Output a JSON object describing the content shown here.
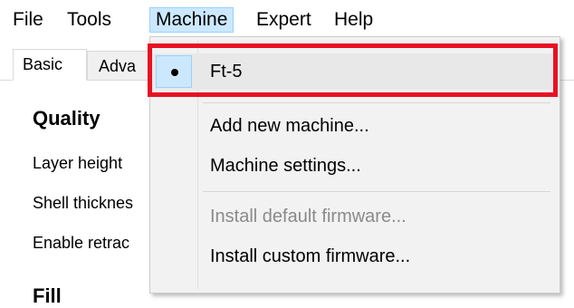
{
  "menubar": {
    "items": [
      {
        "label": "File"
      },
      {
        "label": "Tools"
      },
      {
        "label": "Machine"
      },
      {
        "label": "Expert"
      },
      {
        "label": "Help"
      }
    ],
    "active": "Machine"
  },
  "tabs": [
    {
      "label": "Basic",
      "selected": true
    },
    {
      "label": "Adva",
      "selected": false
    }
  ],
  "panel": {
    "quality_heading": "Quality",
    "layer_height_label": "Layer height",
    "shell_thickness_label": "Shell thicknes",
    "enable_retraction_label": "Enable retrac",
    "fill_heading": "Fill"
  },
  "machine_menu": {
    "current_machine": "Ft-5",
    "add_new_machine": "Add new machine...",
    "machine_settings": "Machine settings...",
    "install_default_firmware": "Install default firmware...",
    "install_default_firmware_enabled": false,
    "install_custom_firmware": "Install custom firmware..."
  },
  "annotation": {
    "highlight_color": "#e81123"
  },
  "icons": {
    "selected_marker": "radio-bullet-icon"
  }
}
